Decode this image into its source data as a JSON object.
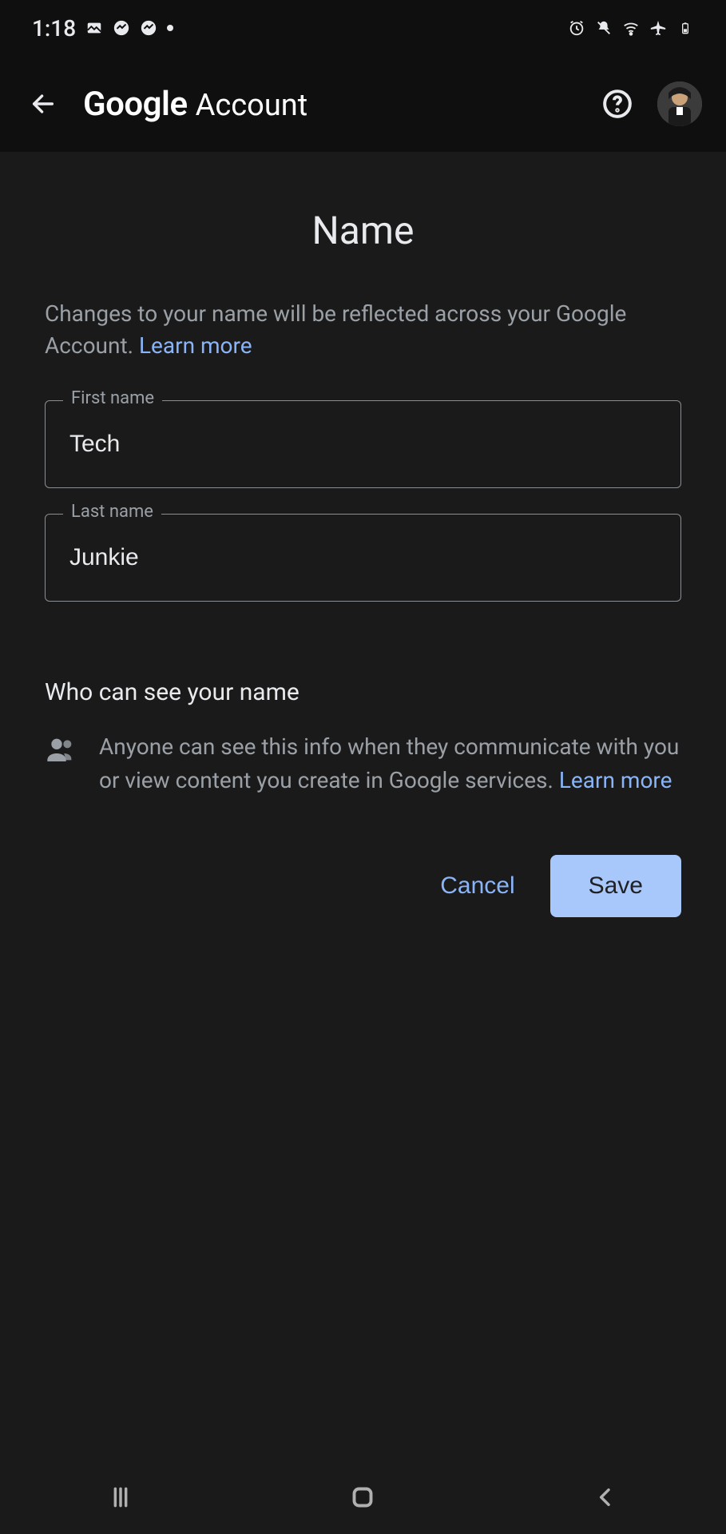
{
  "statusbar": {
    "time": "1:18"
  },
  "header": {
    "brand_google": "Google",
    "brand_account": "Account"
  },
  "page": {
    "title": "Name",
    "subtitle_prefix": "Changes to your name will be reflected across your Google Account. ",
    "subtitle_link": "Learn more"
  },
  "fields": {
    "first_name": {
      "label": "First name",
      "value": "Tech"
    },
    "last_name": {
      "label": "Last name",
      "value": "Junkie"
    }
  },
  "visibility": {
    "heading": "Who can see your name",
    "body_prefix": "Anyone can see this info when they communicate with you or view content you create in Google services. ",
    "body_link": "Learn more"
  },
  "actions": {
    "cancel": "Cancel",
    "save": "Save"
  }
}
